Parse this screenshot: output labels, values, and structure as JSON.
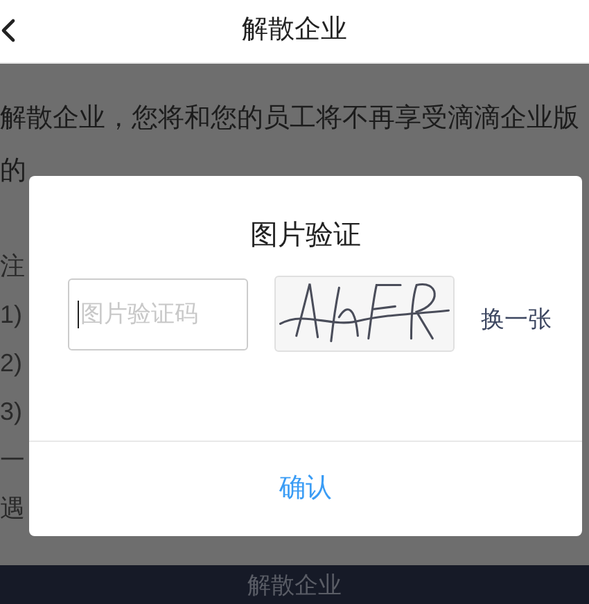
{
  "header": {
    "title": "解散企业"
  },
  "page": {
    "paragraph_lines": [
      "解散企业，您将和您的员工将不再享受滴滴企业版",
      "的"
    ],
    "notes": [
      "注",
      "1)",
      "2)",
      "3)",
      "一",
      "遇"
    ]
  },
  "bottom_button": {
    "label": "解散企业"
  },
  "dialog": {
    "title": "图片验证",
    "code_field": {
      "placeholder": "图片验证码"
    },
    "refresh_link": "换一张",
    "confirm_button": "确认"
  }
}
